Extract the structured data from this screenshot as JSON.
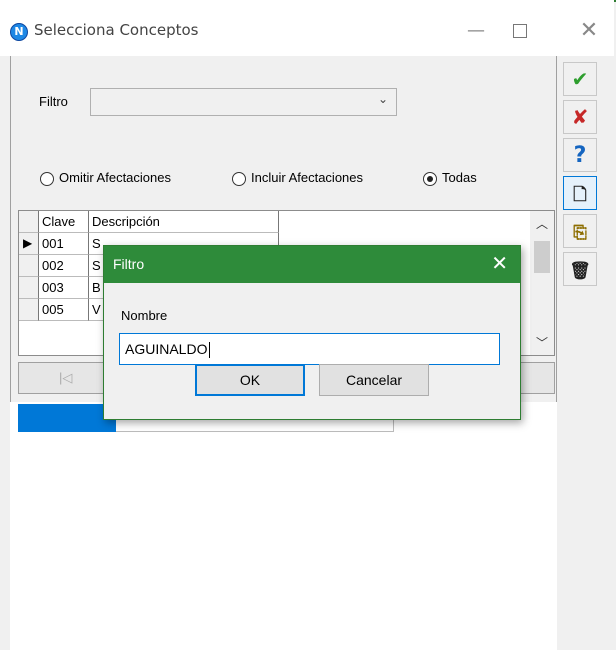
{
  "window": {
    "title": "Selecciona Conceptos",
    "app_icon_letter": "N",
    "minimize": "—",
    "close": "✕"
  },
  "sidebar": {
    "buttons": [
      {
        "icon": "checkmark-icon",
        "glyph": "✔",
        "color": "#2e9e2e"
      },
      {
        "icon": "cancel-x-icon",
        "glyph": "✘",
        "color": "#c62828"
      },
      {
        "icon": "help-question-icon",
        "glyph": "?",
        "color": "#1565c0"
      },
      {
        "icon": "new-document-icon",
        "glyph": "🗋",
        "color": "#222222"
      },
      {
        "icon": "copy-document-icon",
        "glyph": "⎘",
        "color": "#8d6e00"
      },
      {
        "icon": "trash-icon",
        "glyph": "🗑",
        "color": "#222222"
      }
    ]
  },
  "filter": {
    "label": "Filtro",
    "value": "",
    "arrow": "⌄"
  },
  "radios": [
    {
      "label": "Omitir Afectaciones",
      "checked": false
    },
    {
      "label": "Incluir Afectaciones",
      "checked": false
    },
    {
      "label": "Todas",
      "checked": true
    }
  ],
  "grid": {
    "columns": [
      "Clave",
      "Descripción"
    ],
    "rows": [
      {
        "clave": "001",
        "descripcion": "S",
        "current": true
      },
      {
        "clave": "002",
        "descripcion": "S",
        "current": false
      },
      {
        "clave": "003",
        "descripcion": "B",
        "current": false
      },
      {
        "clave": "005",
        "descripcion": "V",
        "current": false
      }
    ],
    "scroll_up": "︿",
    "scroll_down": "﹀"
  },
  "navigator": {
    "first": "|◁"
  },
  "progress": {
    "fraction": 0.26
  },
  "dialog": {
    "title": "Filtro",
    "close": "✕",
    "field_label": "Nombre",
    "field_value": "AGUINALDO",
    "ok": "OK",
    "cancel": "Cancelar"
  },
  "colors": {
    "accent_green": "#2e8b3a",
    "focus_blue": "#0078d7"
  }
}
